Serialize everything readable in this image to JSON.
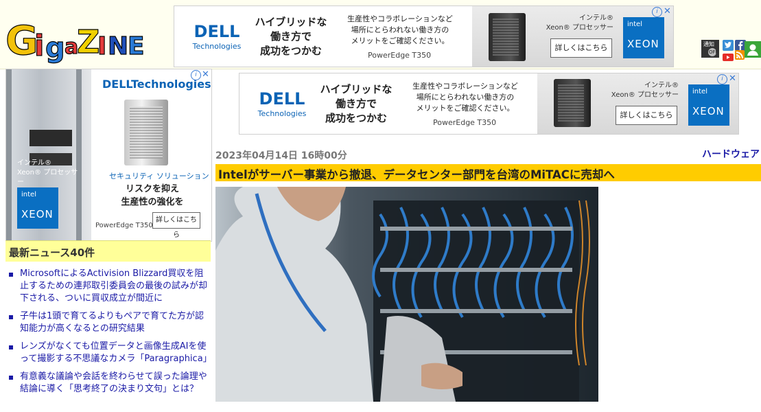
{
  "site": {
    "logo_letters": [
      "G",
      "i",
      "g",
      "a",
      "Z",
      "I",
      "N",
      "E"
    ]
  },
  "header_ad": {
    "brand": "DELL",
    "brand_sub": "Technologies",
    "headline_lines": [
      "ハイブリッドな",
      "働き方で",
      "成功をつかむ"
    ],
    "desc_lines": [
      "生産性やコラボレーションなど",
      "場所にとらわれない働き方の",
      "メリットをご確認ください。"
    ],
    "model": "PowerEdge T350",
    "cta": "詳しくはこちら",
    "xeon_text": [
      "インテル®",
      "Xeon® プロセッサー"
    ],
    "intel_label": "intel",
    "xeon_label": "XEON"
  },
  "header_icons": {
    "notify_label": "通知",
    "notify_state": "OFF"
  },
  "sidebar_ad": {
    "brand_title": "DELLTechnologies",
    "xeon_text": [
      "インテル®",
      "Xeon® プロセッサー"
    ],
    "intel_label": "intel",
    "xeon_label": "XEON",
    "solution": "セキュリティ ソリューション",
    "headline_lines": [
      "リスクを抑え",
      "生産性の強化を"
    ],
    "model": "PowerEdge T350",
    "cta": "詳しくはこちら"
  },
  "sidebar": {
    "news_heading": "最新ニュース40件",
    "news": [
      "MicrosoftによるActivision Blizzard買収を阻止するための連邦取引委員会の最後の試みが却下される、ついに買収成立が間近に",
      "子牛は1頭で育てるよりもペアで育てた方が認知能力が高くなるとの研究結果",
      "レンズがなくても位置データと画像生成AIを使って撮影する不思議なカメラ「Paragraphica」",
      "有意義な議論や会話を終わらせて誤った論理や結論に導く「思考終了の決まり文句」とは？"
    ]
  },
  "main_ad": {
    "brand": "DELL",
    "brand_sub": "Technologies",
    "headline_lines": [
      "ハイブリッドな",
      "働き方で",
      "成功をつかむ"
    ],
    "desc_lines": [
      "生産性やコラボレーションなど",
      "場所にとらわれない働き方の",
      "メリットをご確認ください。"
    ],
    "model": "PowerEdge T350",
    "cta": "詳しくはこちら",
    "xeon_text": [
      "インテル®",
      "Xeon® プロセッサー"
    ],
    "intel_label": "intel",
    "xeon_label": "XEON"
  },
  "article": {
    "date": "2023年04月14日 16時00分",
    "category": "ハードウェア",
    "title": "Intelがサーバー事業から撤退、データセンター部門を台湾のMiTACに売却へ"
  },
  "colors": {
    "title_bar": "#ffcc00",
    "news_heading_bg": "#ffff99",
    "link": "#1a1aa6",
    "dell_blue": "#0b63b5",
    "xeon_blue": "#0a6fc2"
  },
  "icons": [
    "info-icon",
    "close-icon",
    "twitter-icon",
    "facebook-icon",
    "youtube-icon",
    "rss-icon",
    "user-icon",
    "news-bullet-icon"
  ]
}
